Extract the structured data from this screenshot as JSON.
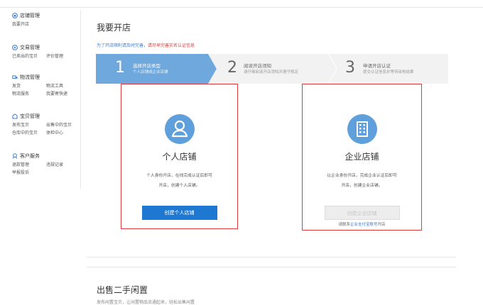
{
  "sidebar": {
    "groups": [
      {
        "title": "店铺管理",
        "icon": "store-icon",
        "rows": [
          [
            "我要开店"
          ]
        ]
      },
      {
        "title": "交易管理",
        "icon": "trade-icon",
        "rows": [
          [
            "已卖出的宝贝",
            "评价管理"
          ]
        ]
      },
      {
        "title": "物流管理",
        "icon": "logistics-icon",
        "rows": [
          [
            "发货",
            "物流工具"
          ],
          [
            "物流服务",
            "我要寄快递"
          ]
        ]
      },
      {
        "title": "宝贝管理",
        "icon": "goods-icon",
        "rows": [
          [
            "发布宝贝",
            "出售中的宝贝"
          ],
          [
            "仓库中的宝贝",
            "体检中心"
          ]
        ]
      },
      {
        "title": "客户服务",
        "icon": "service-icon",
        "rows": [
          [
            "退款管理",
            "违规记录"
          ],
          [
            "举报投诉"
          ]
        ]
      }
    ]
  },
  "main": {
    "title": "我要开店",
    "notice_blue": "为了开店顺利请及时完善，",
    "notice_red": "请尽早完善实名认证信息",
    "steps": [
      {
        "num": "1",
        "title": "选择开店类型",
        "desc": "个人店铺或企业店铺"
      },
      {
        "num": "2",
        "title": "阅读开店须知",
        "desc": "请仔细阅读开店须知并遵守规定"
      },
      {
        "num": "3",
        "title": "申请开店认证",
        "desc": "提交认证信息并等待审核结果"
      }
    ],
    "cards": [
      {
        "title": "个人店铺",
        "desc1": "个人身份开店，在线完成认证后即可",
        "desc2": "开店，创建个人店铺。",
        "button": "创建个人店铺"
      },
      {
        "title": "企业店铺",
        "desc1": "以企业身份开店，完成企业认证后即可",
        "desc2": "开店，创建企业店铺。",
        "button": "创建企业店铺",
        "sub_pre": "请联系",
        "sub_link": "企业支付宝账号",
        "sub_post": "开店"
      }
    ]
  },
  "section2": {
    "title": "出售二手闲置",
    "text": "发布闲置宝贝，让闲置物品流通起来，轻松出售闲置"
  },
  "colors": {
    "accent": "#1e78d2",
    "step_active": "#6fa8dc",
    "highlight": "#e4393c"
  }
}
